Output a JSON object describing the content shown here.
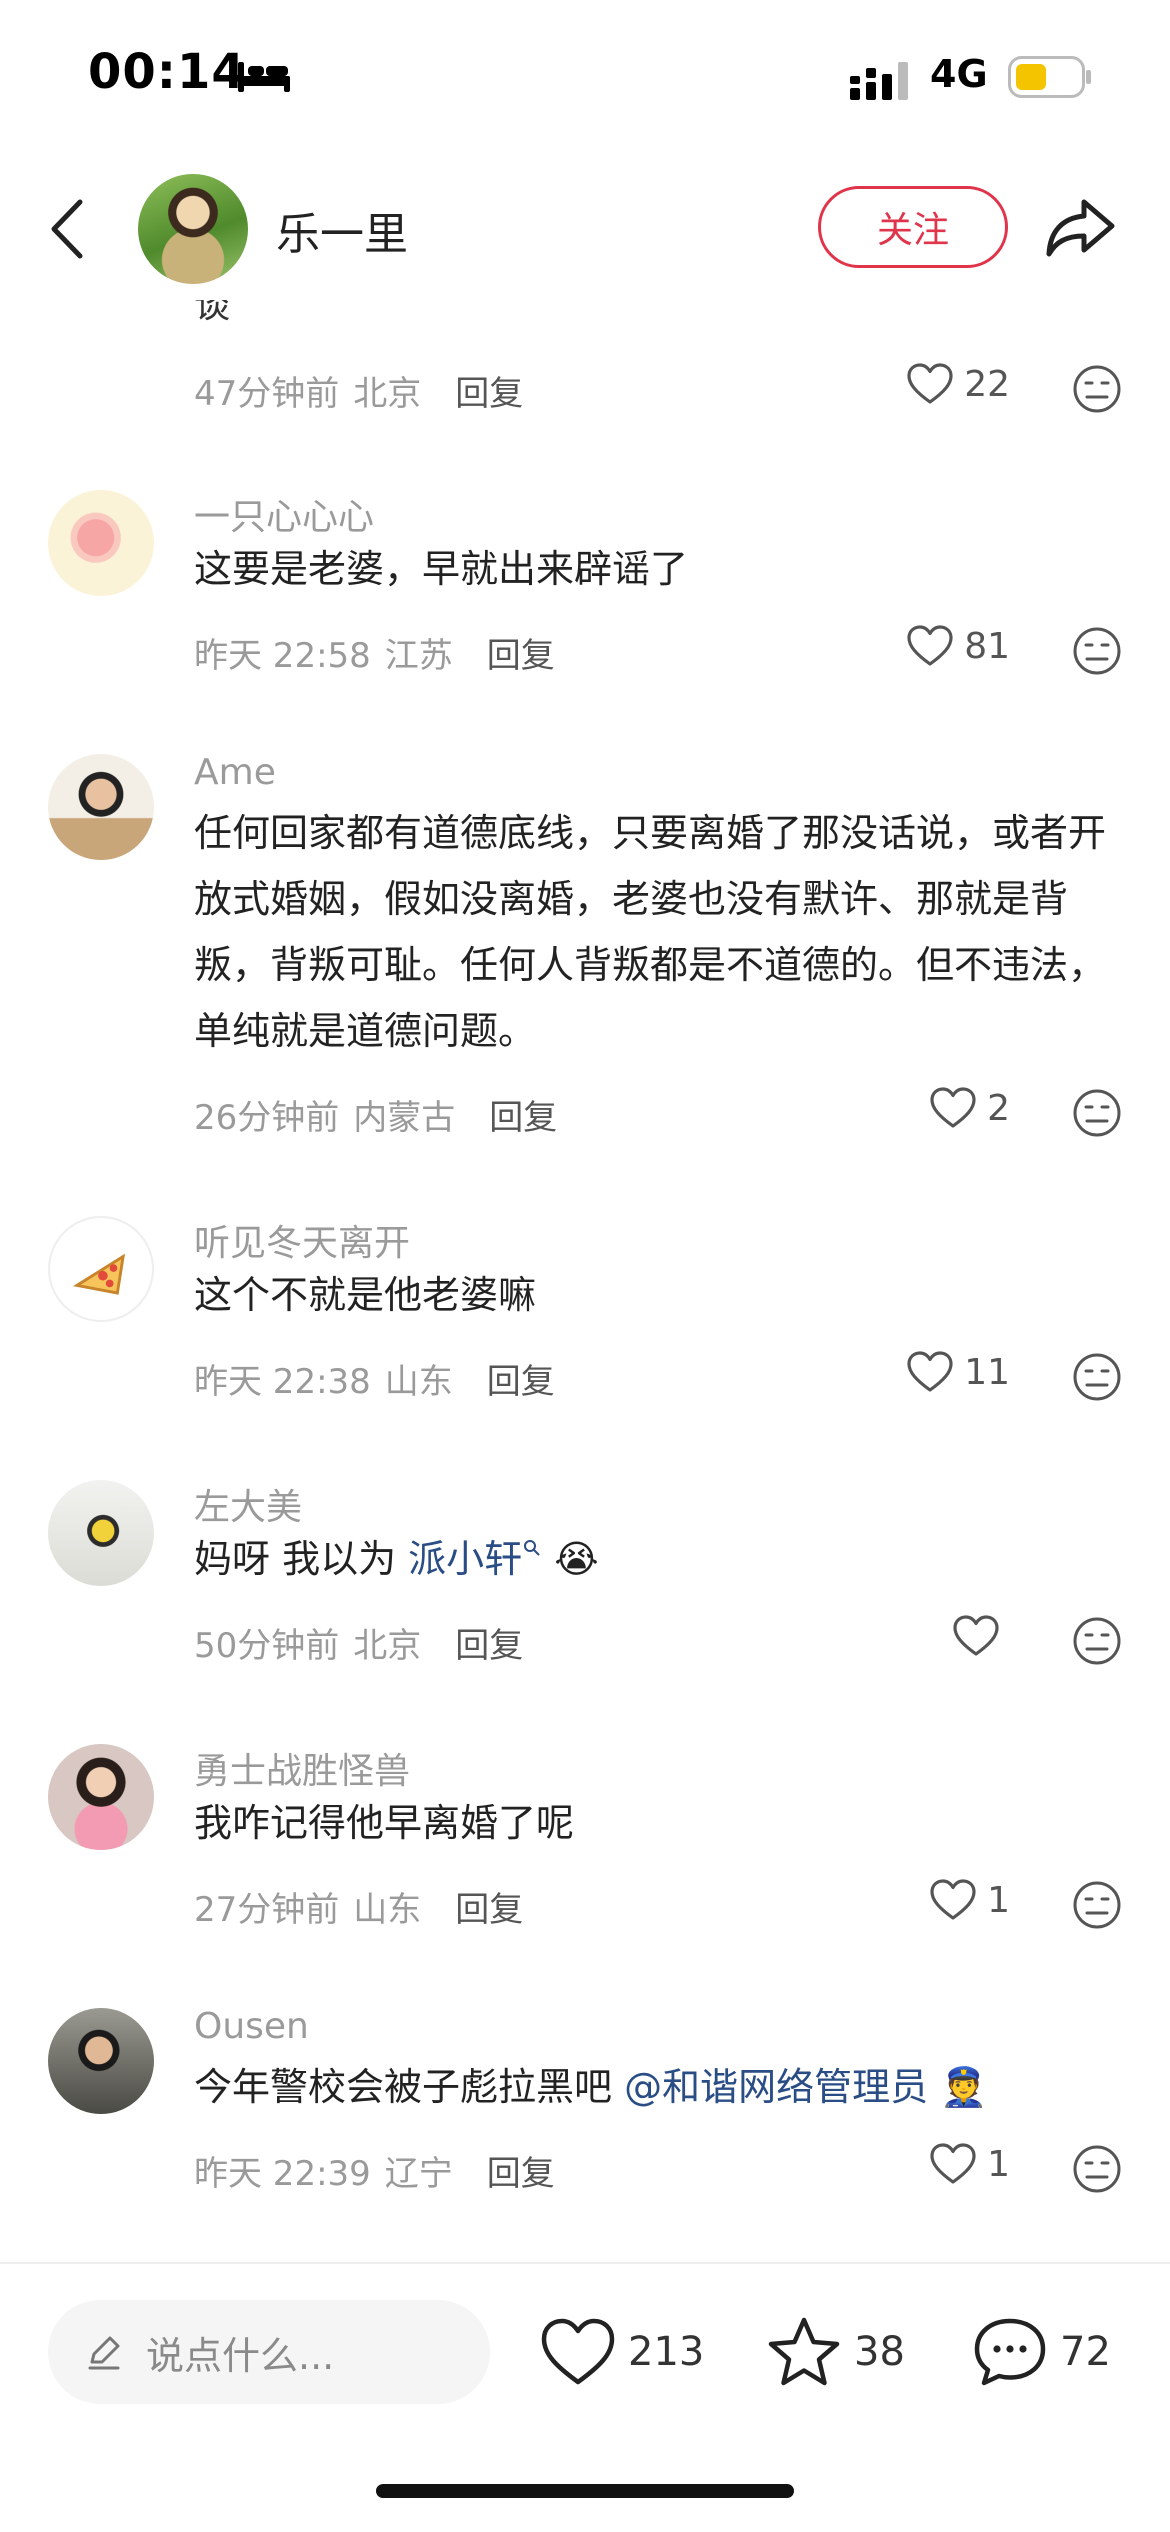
{
  "status_bar": {
    "time": "00:14",
    "network": "4G",
    "battery_color": "#f5c400"
  },
  "header": {
    "author_name": "乐一里",
    "follow_label": "关注",
    "accent": "#e0344b"
  },
  "partial_comment": {
    "text": "谈",
    "time": "47分钟前",
    "location": "北京",
    "reply": "回复",
    "likes": "22"
  },
  "comments": [
    {
      "name": "一只心心心",
      "text": "这要是老婆，早就出来辟谣了",
      "time": "昨天 22:58",
      "location": "江苏",
      "reply": "回复",
      "likes": "81"
    },
    {
      "name": "Ame",
      "text": "任何回家都有道德底线，只要离婚了那没话说，或者开放式婚姻，假如没离婚，老婆也没有默许、那就是背叛，背叛可耻。任何人背叛都是不道德的。但不违法，单纯就是道德问题。",
      "time": "26分钟前",
      "location": "内蒙古",
      "reply": "回复",
      "likes": "2"
    },
    {
      "name": "听见冬天离开",
      "text": "这个不就是他老婆嘛",
      "time": "昨天 22:38",
      "location": "山东",
      "reply": "回复",
      "likes": "11"
    },
    {
      "name": "左大美",
      "text_prefix": "妈呀 我以为 ",
      "mention": "派小轩",
      "emoji": "😭",
      "time": "50分钟前",
      "location": "北京",
      "reply": "回复",
      "likes": ""
    },
    {
      "name": "勇士战胜怪兽",
      "text": "我咋记得他早离婚了呢",
      "time": "27分钟前",
      "location": "山东",
      "reply": "回复",
      "likes": "1"
    },
    {
      "name": "Ousen",
      "text_prefix": "今年警校会被子彪拉黑吧 ",
      "mention": "@和谐网络管理员",
      "emoji": "👮",
      "time": "昨天 22:39",
      "location": "辽宁",
      "reply": "回复",
      "likes": "1"
    }
  ],
  "bottom_bar": {
    "input_placeholder": "说点什么...",
    "likes": "213",
    "favorites": "38",
    "comments": "72"
  }
}
